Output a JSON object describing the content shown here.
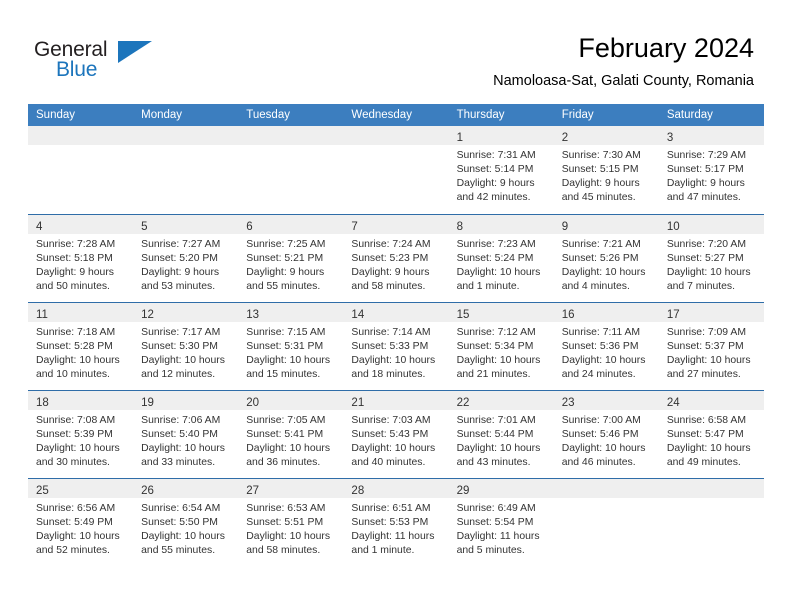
{
  "logo": {
    "word1": "General",
    "word2": "Blue",
    "triangle_color": "#1c75bc",
    "word1_color": "#231f20",
    "word2_color": "#1c75bc"
  },
  "header": {
    "title": "February 2024",
    "subtitle": "Namoloasa-Sat, Galati County, Romania"
  },
  "theme": {
    "header_bg": "#3c7ebf",
    "row_rule": "#2f6da8",
    "daynum_band": "#efefef",
    "text": "#333333"
  },
  "weekdays": [
    "Sunday",
    "Monday",
    "Tuesday",
    "Wednesday",
    "Thursday",
    "Friday",
    "Saturday"
  ],
  "weeks": [
    [
      {
        "day": "",
        "empty": true,
        "sunrise": "",
        "sunset": "",
        "daylight1": "",
        "daylight2": ""
      },
      {
        "day": "",
        "empty": true,
        "sunrise": "",
        "sunset": "",
        "daylight1": "",
        "daylight2": ""
      },
      {
        "day": "",
        "empty": true,
        "sunrise": "",
        "sunset": "",
        "daylight1": "",
        "daylight2": ""
      },
      {
        "day": "",
        "empty": true,
        "sunrise": "",
        "sunset": "",
        "daylight1": "",
        "daylight2": ""
      },
      {
        "day": "1",
        "empty": false,
        "sunrise": "Sunrise: 7:31 AM",
        "sunset": "Sunset: 5:14 PM",
        "daylight1": "Daylight: 9 hours",
        "daylight2": "and 42 minutes."
      },
      {
        "day": "2",
        "empty": false,
        "sunrise": "Sunrise: 7:30 AM",
        "sunset": "Sunset: 5:15 PM",
        "daylight1": "Daylight: 9 hours",
        "daylight2": "and 45 minutes."
      },
      {
        "day": "3",
        "empty": false,
        "sunrise": "Sunrise: 7:29 AM",
        "sunset": "Sunset: 5:17 PM",
        "daylight1": "Daylight: 9 hours",
        "daylight2": "and 47 minutes."
      }
    ],
    [
      {
        "day": "4",
        "empty": false,
        "sunrise": "Sunrise: 7:28 AM",
        "sunset": "Sunset: 5:18 PM",
        "daylight1": "Daylight: 9 hours",
        "daylight2": "and 50 minutes."
      },
      {
        "day": "5",
        "empty": false,
        "sunrise": "Sunrise: 7:27 AM",
        "sunset": "Sunset: 5:20 PM",
        "daylight1": "Daylight: 9 hours",
        "daylight2": "and 53 minutes."
      },
      {
        "day": "6",
        "empty": false,
        "sunrise": "Sunrise: 7:25 AM",
        "sunset": "Sunset: 5:21 PM",
        "daylight1": "Daylight: 9 hours",
        "daylight2": "and 55 minutes."
      },
      {
        "day": "7",
        "empty": false,
        "sunrise": "Sunrise: 7:24 AM",
        "sunset": "Sunset: 5:23 PM",
        "daylight1": "Daylight: 9 hours",
        "daylight2": "and 58 minutes."
      },
      {
        "day": "8",
        "empty": false,
        "sunrise": "Sunrise: 7:23 AM",
        "sunset": "Sunset: 5:24 PM",
        "daylight1": "Daylight: 10 hours",
        "daylight2": "and 1 minute."
      },
      {
        "day": "9",
        "empty": false,
        "sunrise": "Sunrise: 7:21 AM",
        "sunset": "Sunset: 5:26 PM",
        "daylight1": "Daylight: 10 hours",
        "daylight2": "and 4 minutes."
      },
      {
        "day": "10",
        "empty": false,
        "sunrise": "Sunrise: 7:20 AM",
        "sunset": "Sunset: 5:27 PM",
        "daylight1": "Daylight: 10 hours",
        "daylight2": "and 7 minutes."
      }
    ],
    [
      {
        "day": "11",
        "empty": false,
        "sunrise": "Sunrise: 7:18 AM",
        "sunset": "Sunset: 5:28 PM",
        "daylight1": "Daylight: 10 hours",
        "daylight2": "and 10 minutes."
      },
      {
        "day": "12",
        "empty": false,
        "sunrise": "Sunrise: 7:17 AM",
        "sunset": "Sunset: 5:30 PM",
        "daylight1": "Daylight: 10 hours",
        "daylight2": "and 12 minutes."
      },
      {
        "day": "13",
        "empty": false,
        "sunrise": "Sunrise: 7:15 AM",
        "sunset": "Sunset: 5:31 PM",
        "daylight1": "Daylight: 10 hours",
        "daylight2": "and 15 minutes."
      },
      {
        "day": "14",
        "empty": false,
        "sunrise": "Sunrise: 7:14 AM",
        "sunset": "Sunset: 5:33 PM",
        "daylight1": "Daylight: 10 hours",
        "daylight2": "and 18 minutes."
      },
      {
        "day": "15",
        "empty": false,
        "sunrise": "Sunrise: 7:12 AM",
        "sunset": "Sunset: 5:34 PM",
        "daylight1": "Daylight: 10 hours",
        "daylight2": "and 21 minutes."
      },
      {
        "day": "16",
        "empty": false,
        "sunrise": "Sunrise: 7:11 AM",
        "sunset": "Sunset: 5:36 PM",
        "daylight1": "Daylight: 10 hours",
        "daylight2": "and 24 minutes."
      },
      {
        "day": "17",
        "empty": false,
        "sunrise": "Sunrise: 7:09 AM",
        "sunset": "Sunset: 5:37 PM",
        "daylight1": "Daylight: 10 hours",
        "daylight2": "and 27 minutes."
      }
    ],
    [
      {
        "day": "18",
        "empty": false,
        "sunrise": "Sunrise: 7:08 AM",
        "sunset": "Sunset: 5:39 PM",
        "daylight1": "Daylight: 10 hours",
        "daylight2": "and 30 minutes."
      },
      {
        "day": "19",
        "empty": false,
        "sunrise": "Sunrise: 7:06 AM",
        "sunset": "Sunset: 5:40 PM",
        "daylight1": "Daylight: 10 hours",
        "daylight2": "and 33 minutes."
      },
      {
        "day": "20",
        "empty": false,
        "sunrise": "Sunrise: 7:05 AM",
        "sunset": "Sunset: 5:41 PM",
        "daylight1": "Daylight: 10 hours",
        "daylight2": "and 36 minutes."
      },
      {
        "day": "21",
        "empty": false,
        "sunrise": "Sunrise: 7:03 AM",
        "sunset": "Sunset: 5:43 PM",
        "daylight1": "Daylight: 10 hours",
        "daylight2": "and 40 minutes."
      },
      {
        "day": "22",
        "empty": false,
        "sunrise": "Sunrise: 7:01 AM",
        "sunset": "Sunset: 5:44 PM",
        "daylight1": "Daylight: 10 hours",
        "daylight2": "and 43 minutes."
      },
      {
        "day": "23",
        "empty": false,
        "sunrise": "Sunrise: 7:00 AM",
        "sunset": "Sunset: 5:46 PM",
        "daylight1": "Daylight: 10 hours",
        "daylight2": "and 46 minutes."
      },
      {
        "day": "24",
        "empty": false,
        "sunrise": "Sunrise: 6:58 AM",
        "sunset": "Sunset: 5:47 PM",
        "daylight1": "Daylight: 10 hours",
        "daylight2": "and 49 minutes."
      }
    ],
    [
      {
        "day": "25",
        "empty": false,
        "sunrise": "Sunrise: 6:56 AM",
        "sunset": "Sunset: 5:49 PM",
        "daylight1": "Daylight: 10 hours",
        "daylight2": "and 52 minutes."
      },
      {
        "day": "26",
        "empty": false,
        "sunrise": "Sunrise: 6:54 AM",
        "sunset": "Sunset: 5:50 PM",
        "daylight1": "Daylight: 10 hours",
        "daylight2": "and 55 minutes."
      },
      {
        "day": "27",
        "empty": false,
        "sunrise": "Sunrise: 6:53 AM",
        "sunset": "Sunset: 5:51 PM",
        "daylight1": "Daylight: 10 hours",
        "daylight2": "and 58 minutes."
      },
      {
        "day": "28",
        "empty": false,
        "sunrise": "Sunrise: 6:51 AM",
        "sunset": "Sunset: 5:53 PM",
        "daylight1": "Daylight: 11 hours",
        "daylight2": "and 1 minute."
      },
      {
        "day": "29",
        "empty": false,
        "sunrise": "Sunrise: 6:49 AM",
        "sunset": "Sunset: 5:54 PM",
        "daylight1": "Daylight: 11 hours",
        "daylight2": "and 5 minutes."
      },
      {
        "day": "",
        "empty": true,
        "sunrise": "",
        "sunset": "",
        "daylight1": "",
        "daylight2": ""
      },
      {
        "day": "",
        "empty": true,
        "sunrise": "",
        "sunset": "",
        "daylight1": "",
        "daylight2": ""
      }
    ]
  ]
}
